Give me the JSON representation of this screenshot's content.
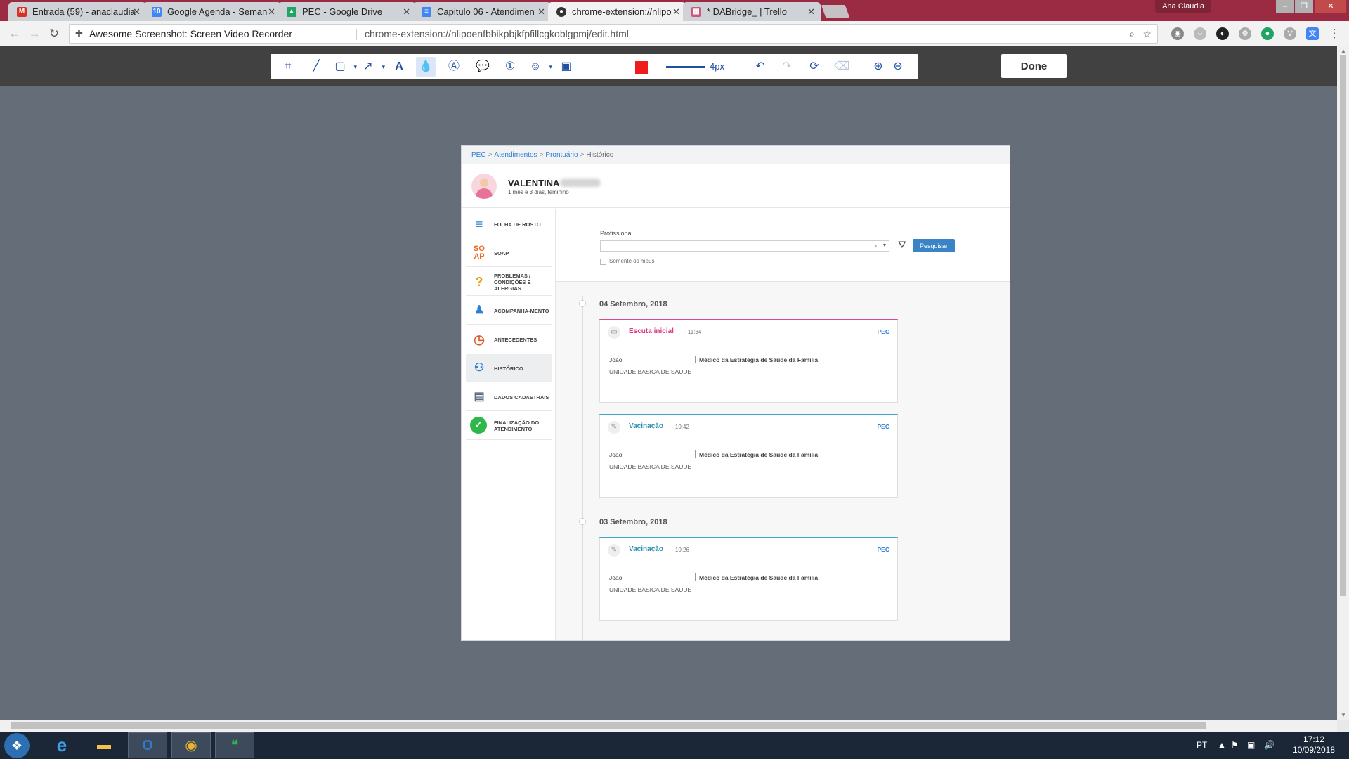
{
  "browser": {
    "tabs": [
      {
        "title": "Entrada (59) - anaclaudia",
        "icon": "gmail-icon",
        "color": "#d93025",
        "glyph": "M"
      },
      {
        "title": "Google Agenda - Seman",
        "icon": "calendar-icon",
        "color": "#4285f4",
        "glyph": "10"
      },
      {
        "title": "PEC - Google Drive",
        "icon": "drive-icon",
        "color": "#1fa463",
        "glyph": "▲"
      },
      {
        "title": "Capitulo 06 - Atendimen",
        "icon": "docs-icon",
        "color": "#4285f4",
        "glyph": "≡"
      },
      {
        "title": "chrome-extension://nlipo",
        "icon": "extension-icon",
        "color": "#333333",
        "glyph": "●"
      },
      {
        "title": "* DABridge_ | Trello",
        "icon": "trello-icon",
        "color": "#c9587a",
        "glyph": "▦"
      }
    ],
    "user": "Ana Claudia",
    "site_name": "Awesome Screenshot: Screen Video Recorder",
    "url": "chrome-extension://nlipoenfbbikpbjkfpfillcgkoblgpmj/edit.html"
  },
  "editor": {
    "line_size": "4px",
    "done_label": "Done",
    "color": "#ee1c1c"
  },
  "shot": {
    "breadcrumb": {
      "pec": "PEC",
      "atendimentos": "Atendimentos",
      "prontuario": "Prontuário",
      "historico": "Histórico",
      "sep": ">"
    },
    "patient": {
      "name": "VALENTINA",
      "meta": "1 mês e 3 dias, feminino"
    },
    "menu": [
      {
        "label": "FOLHA DE ROSTO",
        "icon": "document-icon",
        "glyph": "≡",
        "color": "#2c7ed6"
      },
      {
        "label": "SOAP",
        "icon": "soap-icon",
        "glyph": "SO AP",
        "color": "#e86a1c"
      },
      {
        "label": "PROBLEMAS / CONDIÇÕES E ALERGIAS",
        "icon": "problems-icon",
        "glyph": "?",
        "color": "#e8a020"
      },
      {
        "label": "ACOMPANHA-MENTO",
        "icon": "person-icon",
        "glyph": "👤",
        "color": "#2c7ed6"
      },
      {
        "label": "ANTECEDENTES",
        "icon": "clock-history-icon",
        "glyph": "◷",
        "color": "#e05a2a"
      },
      {
        "label": "HISTÓRICO",
        "icon": "history-people-icon",
        "glyph": "⚇",
        "color": "#2c7ed6"
      },
      {
        "label": "DADOS CADASTRAIS",
        "icon": "id-card-icon",
        "glyph": "▤",
        "color": "#5a6b80"
      },
      {
        "label": "FINALIZAÇÃO DO ATENDIMENTO",
        "icon": "check-icon",
        "glyph": "✓",
        "color": "#2eb84a"
      }
    ],
    "filter": {
      "label": "Profissional",
      "clear": "×",
      "button": "Pesquisar",
      "checkbox_label": "Somente os meus"
    },
    "dates": [
      "04 Setembro, 2018",
      "03 Setembro, 2018"
    ],
    "cards": [
      {
        "title": "Escuta inicial",
        "time": "- 11:34",
        "source": "PEC",
        "professional": "Joao",
        "role": "Médico da Estratégia de Saúde da Família",
        "unit": "UNIDADE BASICA DE SAUDE"
      },
      {
        "title": "Vacinação",
        "time": "- 10:42",
        "source": "PEC",
        "professional": "Joao",
        "role": "Médico da Estratégia de Saúde da Família",
        "unit": "UNIDADE BASICA DE SAUDE"
      },
      {
        "title": "Vacinação",
        "time": "- 10:26",
        "source": "PEC",
        "professional": "Joao",
        "role": "Médico da Estratégia de Saúde da Família",
        "unit": "UNIDADE BASICA DE SAUDE"
      }
    ]
  },
  "taskbar": {
    "language": "PT",
    "time": "17:12",
    "date": "10/09/2018"
  }
}
